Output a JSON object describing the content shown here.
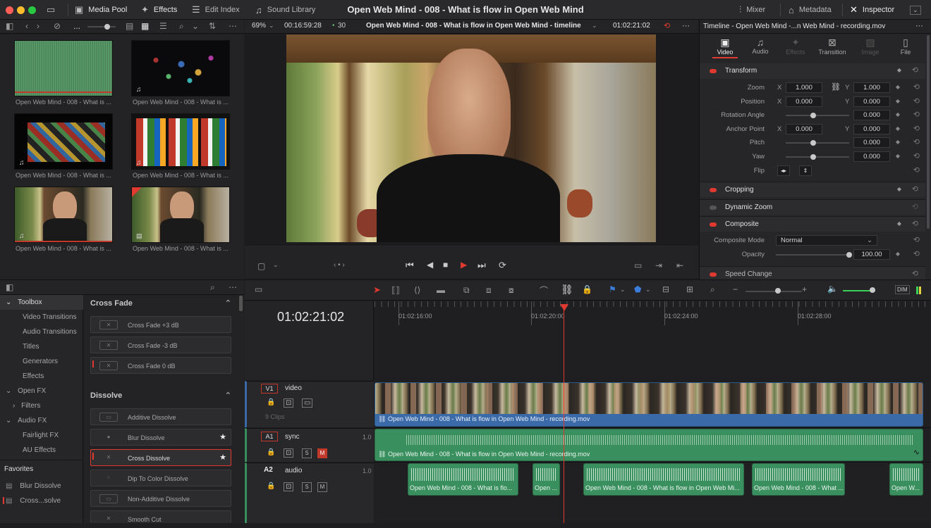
{
  "window": {
    "title": "Open Web Mind - 008 - What is flow in Open Web Mind"
  },
  "toolbar": {
    "media_pool": "Media Pool",
    "effects": "Effects",
    "edit_index": "Edit Index",
    "sound_library": "Sound Library",
    "mixer": "Mixer",
    "metadata": "Metadata",
    "inspector": "Inspector"
  },
  "viewer": {
    "zoom": "69%",
    "timecode_duration": "00:16:59:28",
    "fps": "30",
    "timeline_name": "Open Web Mind - 008 - What is flow in Open Web Mind - timeline",
    "timecode_current": "01:02:21:02"
  },
  "media_pool": {
    "more": "...",
    "clips": [
      {
        "label": "Open Web Mind - 008 - What is ..."
      },
      {
        "label": "Open Web Mind - 008 - What is ..."
      },
      {
        "label": "Open Web Mind - 008 - What is ..."
      },
      {
        "label": "Open Web Mind - 008 - What is ..."
      },
      {
        "label": "Open Web Mind - 008 - What is ..."
      },
      {
        "label": "Open Web Mind - 008 - What is ..."
      }
    ]
  },
  "effects_tree": {
    "items": [
      {
        "label": "Toolbox"
      },
      {
        "label": "Video Transitions"
      },
      {
        "label": "Audio Transitions"
      },
      {
        "label": "Titles"
      },
      {
        "label": "Generators"
      },
      {
        "label": "Effects"
      },
      {
        "label": "Open FX"
      },
      {
        "label": "Filters"
      },
      {
        "label": "Audio FX"
      },
      {
        "label": "Fairlight FX"
      },
      {
        "label": "AU Effects"
      }
    ],
    "favorites_title": "Favorites",
    "favorites": [
      {
        "label": "Blur Dissolve"
      },
      {
        "label": "Cross...solve"
      }
    ]
  },
  "effects_list": {
    "cross_fade_title": "Cross Fade",
    "cross_fade": [
      {
        "label": "Cross Fade +3 dB"
      },
      {
        "label": "Cross Fade -3 dB"
      },
      {
        "label": "Cross Fade 0 dB"
      }
    ],
    "dissolve_title": "Dissolve",
    "dissolve": [
      {
        "label": "Additive Dissolve"
      },
      {
        "label": "Blur Dissolve"
      },
      {
        "label": "Cross Dissolve"
      },
      {
        "label": "Dip To Color Dissolve"
      },
      {
        "label": "Non-Additive Dissolve"
      },
      {
        "label": "Smooth Cut"
      }
    ]
  },
  "inspector": {
    "header": "Timeline - Open Web Mind -...n Web Mind - recording.mov",
    "tabs": [
      {
        "label": "Video"
      },
      {
        "label": "Audio"
      },
      {
        "label": "Effects"
      },
      {
        "label": "Transition"
      },
      {
        "label": "Image"
      },
      {
        "label": "File"
      }
    ],
    "transform": {
      "title": "Transform",
      "zoom_label": "Zoom",
      "zoom_x": "1.000",
      "zoom_y": "1.000",
      "position_label": "Position",
      "position_x": "0.000",
      "position_y": "0.000",
      "rotation_label": "Rotation Angle",
      "rotation": "0.000",
      "anchor_label": "Anchor Point",
      "anchor_x": "0.000",
      "anchor_y": "0.000",
      "pitch_label": "Pitch",
      "pitch": "0.000",
      "yaw_label": "Yaw",
      "yaw": "0.000",
      "flip_label": "Flip",
      "x": "X",
      "y": "Y"
    },
    "cropping": "Cropping",
    "dynamic_zoom": "Dynamic Zoom",
    "composite": {
      "title": "Composite",
      "mode_label": "Composite Mode",
      "mode": "Normal",
      "opacity_label": "Opacity",
      "opacity": "100.00"
    },
    "speed_change": "Speed Change"
  },
  "timeline": {
    "timecode": "01:02:21:02",
    "ruler": [
      "01:02:16:00",
      "01:02:20:00",
      "01:02:24:00",
      "01:02:28:00"
    ],
    "dim": "DIM",
    "tracks": {
      "v1": {
        "id": "V1",
        "name": "video",
        "count": "9 Clips",
        "clip": "Open Web Mind - 008 - What is flow in Open Web Mind - recording.mov"
      },
      "a1": {
        "id": "A1",
        "name": "sync",
        "level": "1.0",
        "clip": "Open Web Mind - 008 - What is flow in Open Web Mind - recording.mov"
      },
      "a2": {
        "id": "A2",
        "name": "audio",
        "level": "1.0",
        "clips": [
          "Open Web Mind - 008 - What is flo...",
          "Open ...",
          "Open Web Mind - 008 - What is flow in Open Web Mi...",
          "Open Web Mind - 008 - What ...",
          "Open W..."
        ]
      }
    },
    "solo": "S",
    "mute": "M"
  }
}
